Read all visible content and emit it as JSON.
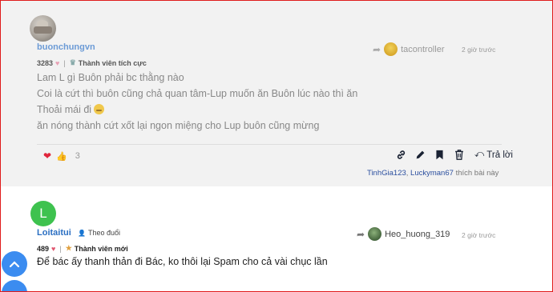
{
  "post1": {
    "username": "buonchungvn",
    "points": "3283",
    "rank": "Thành viên tích cực",
    "reply_to_user": "tacontroller",
    "time": "2 giờ trước",
    "lines": [
      "Lam L gì Buôn phải bc thằng nào",
      "Coi là cứt thì buôn cũng chả quan tâm-Lup muốn ăn Buôn lúc nào thì ăn",
      "Thoải mái đi",
      "ăn nóng thành cứt xốt lại ngon miệng cho Lup buôn cũng mừng"
    ],
    "reaction_count": "3",
    "reply_label": "Trả lời",
    "likes": {
      "users": [
        "TinhGia123",
        "Luckyman67"
      ],
      "suffix": "thích bài này"
    }
  },
  "post2": {
    "avatar_letter": "L",
    "username": "Loitaitui",
    "follow_label": "Theo đuổi",
    "points": "489",
    "rank": "Thành viên mới",
    "reply_to_user": "Heo_huong_319",
    "time": "2 giờ trước",
    "text": "Để bác ấy thanh thản đi Bác, ko thôi lại Spam cho cả vài chục lần"
  },
  "colors": {
    "frame": "#e01b1b",
    "username": "#6c9bd6",
    "avatar_green": "#3ec24f",
    "fab_blue": "#3b8cf0"
  }
}
